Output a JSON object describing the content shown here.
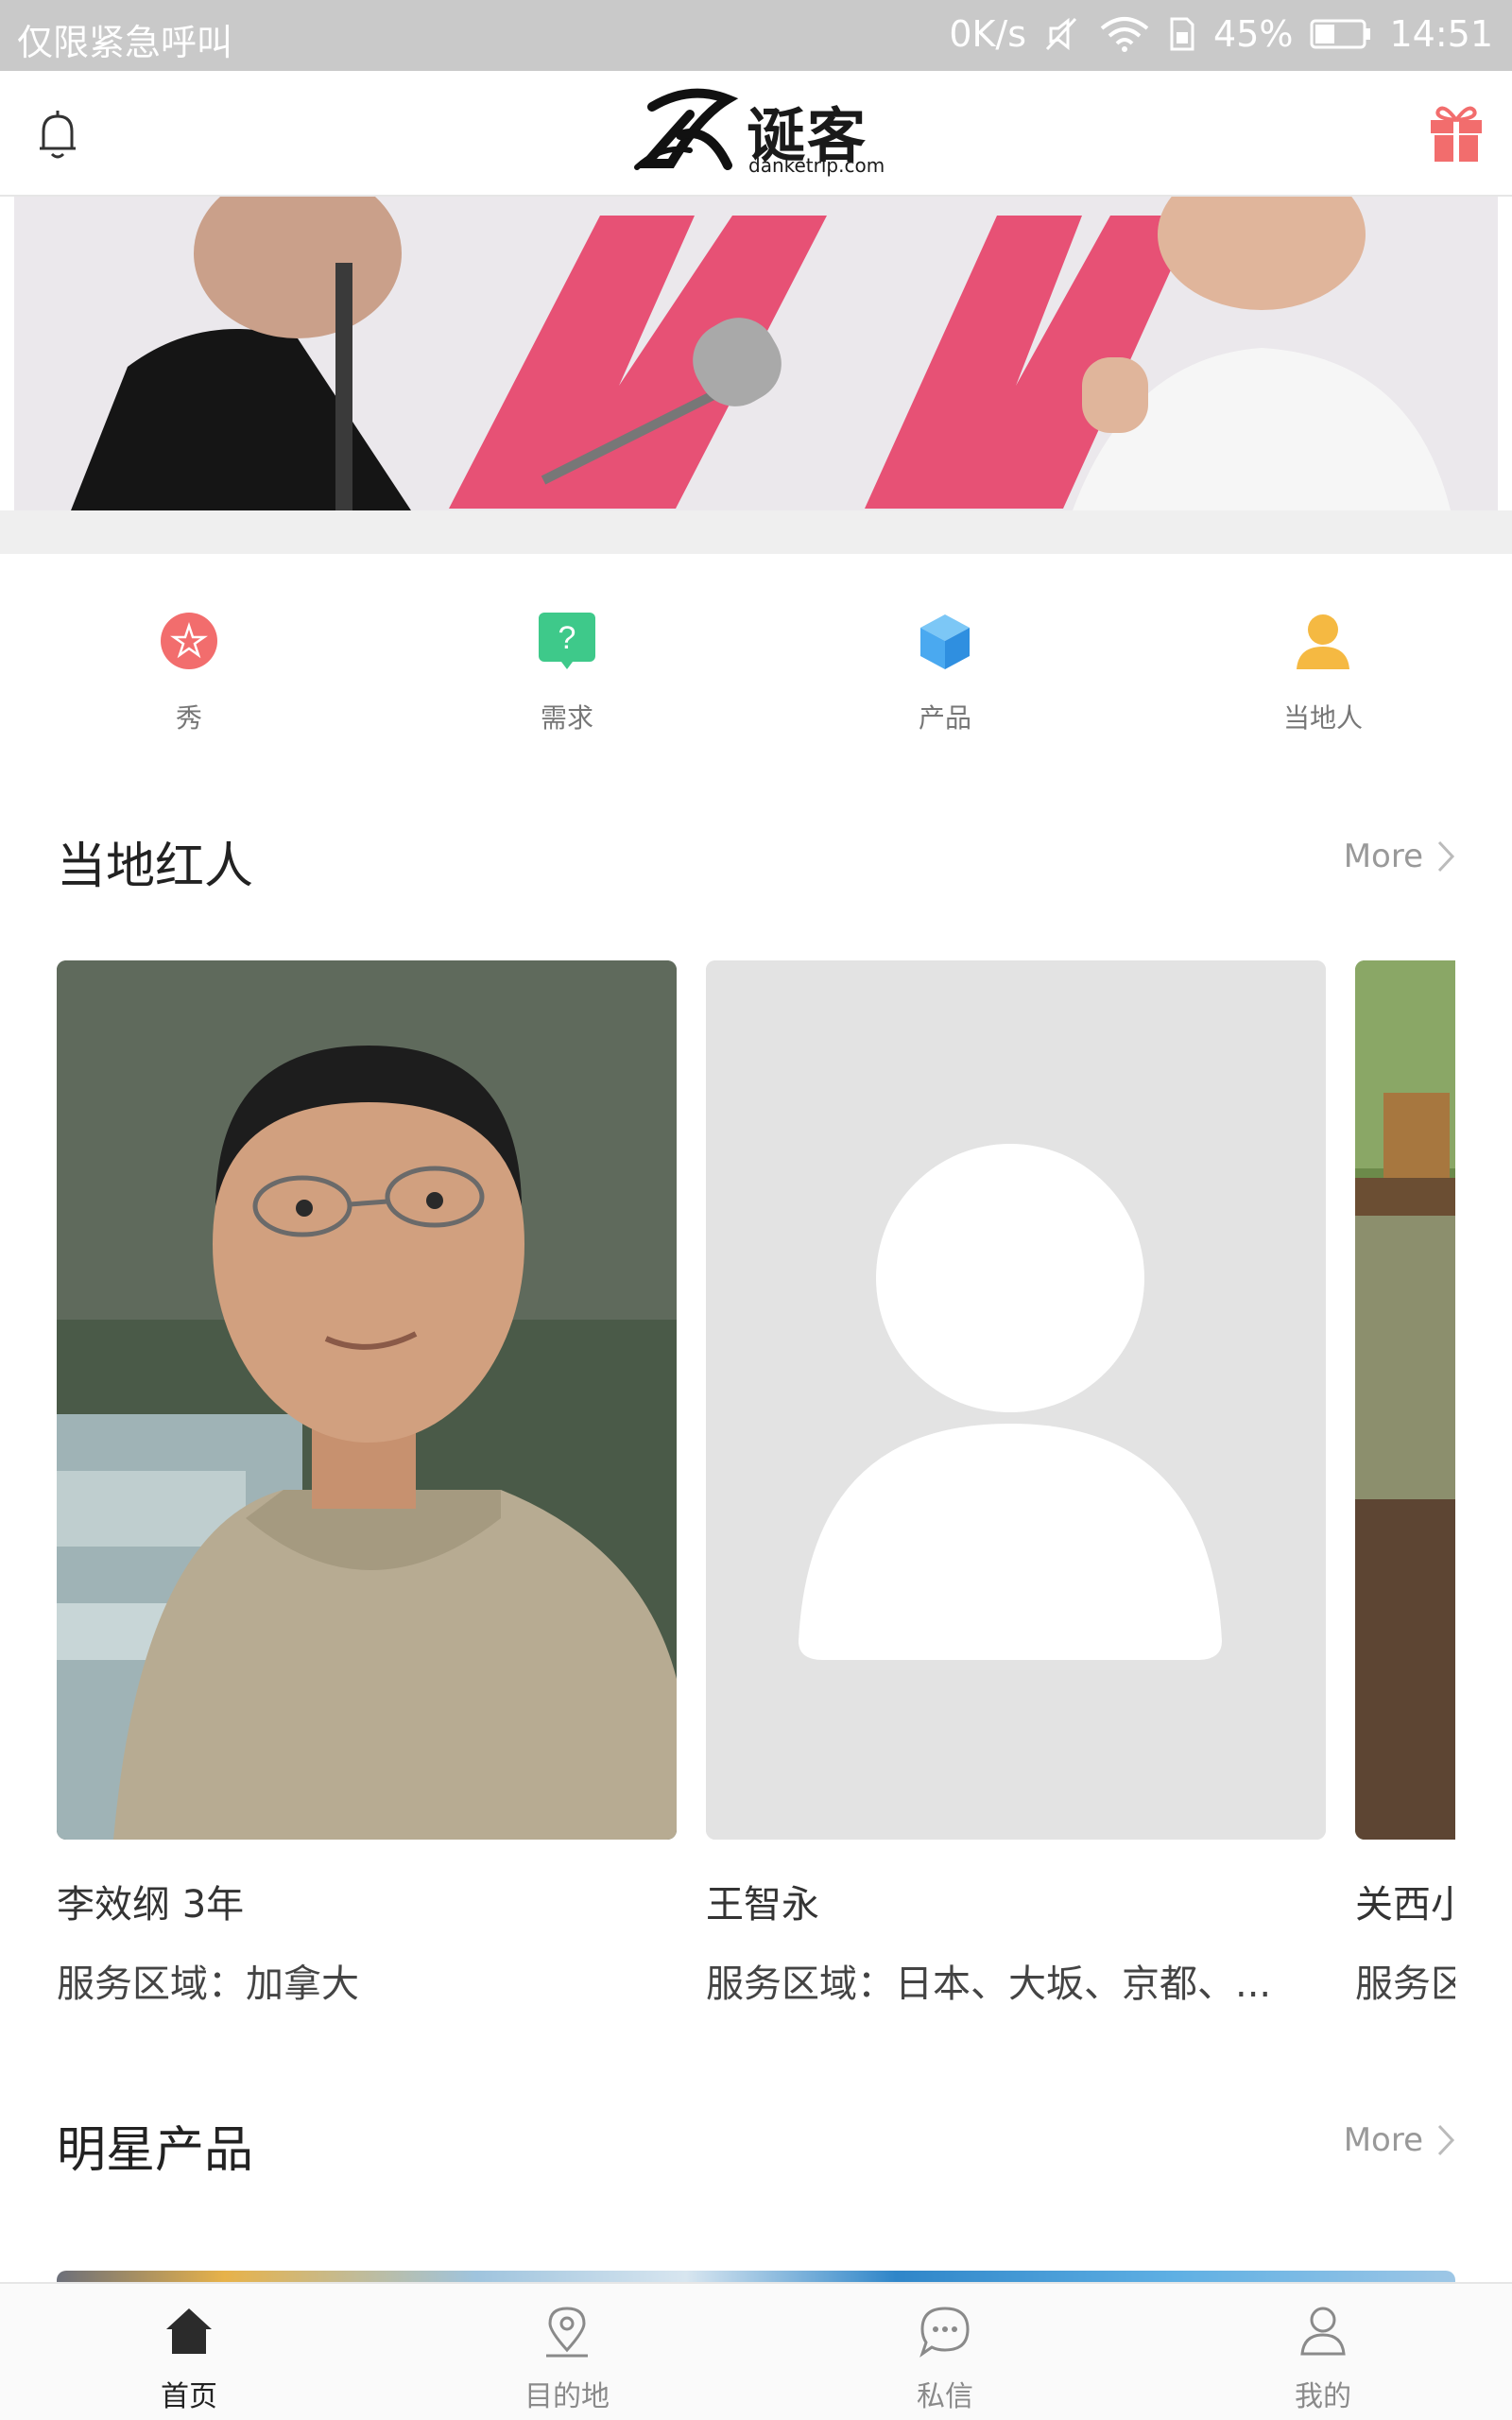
{
  "status_bar": {
    "carrier_text": "仅限紧急呼叫",
    "speed": "0K/s",
    "battery": "45%",
    "time": "14:51"
  },
  "header": {
    "brand_name": "诞客",
    "brand_domain": "danketrip.com",
    "left_icon": "bell-icon",
    "right_icon": "gift-icon"
  },
  "categories": [
    {
      "label": "秀",
      "icon": "star-badge-icon",
      "color": "#f26d6d"
    },
    {
      "label": "需求",
      "icon": "question-bubble-icon",
      "color": "#3ec98a"
    },
    {
      "label": "产品",
      "icon": "cube-icon",
      "color": "#4aa9f0"
    },
    {
      "label": "当地人",
      "icon": "person-icon",
      "color": "#f5b942"
    }
  ],
  "local_stars": {
    "title": "当地红人",
    "more": "More",
    "cards": [
      {
        "name": "李效纲 3年",
        "area": "服务区域：加拿大"
      },
      {
        "name": "王智永",
        "area": "服务区域：日本、大坂、京都、..."
      },
      {
        "name": "关西小",
        "area": "服务区"
      }
    ]
  },
  "star_products": {
    "title": "明星产品",
    "more": "More"
  },
  "tabbar": [
    {
      "label": "首页",
      "icon": "home-icon",
      "active": true
    },
    {
      "label": "目的地",
      "icon": "location-pin-icon",
      "active": false
    },
    {
      "label": "私信",
      "icon": "chat-bubble-icon",
      "active": false
    },
    {
      "label": "我的",
      "icon": "user-icon",
      "active": false
    }
  ],
  "colors": {
    "accent_red": "#f26d6d",
    "text_dark": "#222222",
    "text_muted": "#999999"
  }
}
